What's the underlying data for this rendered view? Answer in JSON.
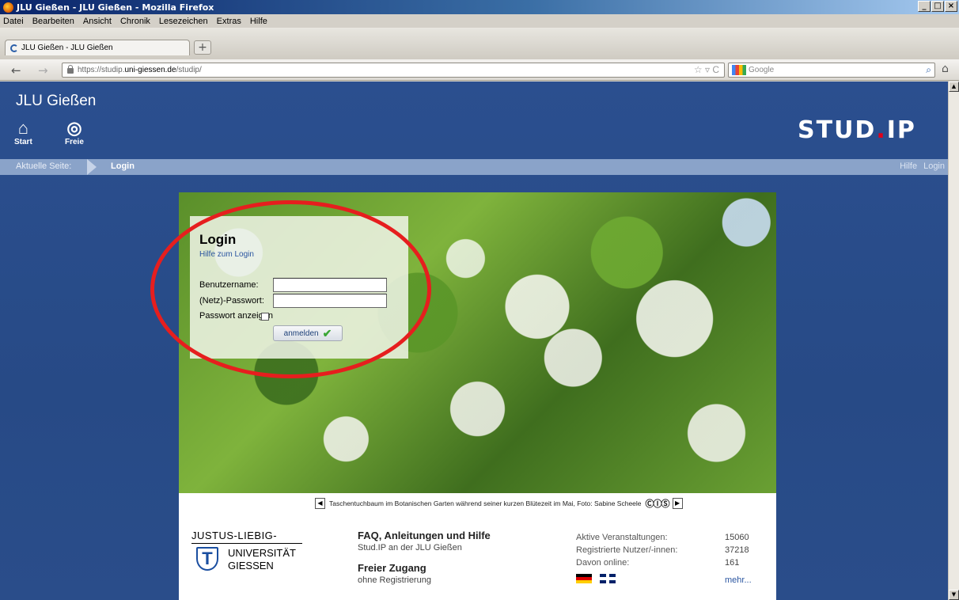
{
  "window": {
    "title": "JLU Gießen - JLU Gießen - Mozilla Firefox",
    "min": "_",
    "max": "□",
    "close": "×"
  },
  "menu": [
    "Datei",
    "Bearbeiten",
    "Ansicht",
    "Chronik",
    "Lesezeichen",
    "Extras",
    "Hilfe"
  ],
  "tab": {
    "label": "JLU Gießen - JLU Gießen",
    "new_tab": "+"
  },
  "nav": {
    "back": "←",
    "forward": "→",
    "url_prefix": "https://studip.",
    "url_host": "uni-giessen.de",
    "url_path": "/studip/",
    "url_icons": "☆ ▿ C",
    "search_placeholder": "Google",
    "search_icon": "⌕",
    "home_icon": "⌂"
  },
  "site": {
    "title": "JLU Gießen",
    "nav_items": [
      {
        "label": "Start",
        "icon": "home-icon",
        "glyph": "⌂"
      },
      {
        "label": "Freie",
        "icon": "freie-icon",
        "glyph": "◎"
      }
    ],
    "logo_main": "STUD",
    "logo_dot": ".",
    "logo_end": "IP"
  },
  "breadcrumb": {
    "label": "Aktuelle Seite:",
    "current": "Login",
    "right": [
      "Hilfe",
      "Login"
    ]
  },
  "login": {
    "title": "Login",
    "help": "Hilfe zum Login",
    "username_label": "Benutzername:",
    "password_label": "(Netz)-Passwort:",
    "show_password_label": "Passwort anzeigen",
    "submit_label": "anmelden",
    "submit_icon": "✔"
  },
  "caption": {
    "prev": "◀",
    "text": "Taschentuchbaum im Botanischen Garten während seiner kurzen Blütezeit im Mai, Foto: Sabine Scheele",
    "cc": "ⒸⒾⓈ",
    "next": "▶"
  },
  "university": {
    "line1": "JUSTUS-LIEBIG-",
    "line2": "UNIVERSITÄT",
    "line3": "GIESSEN",
    "mark": "T"
  },
  "faq": {
    "title": "FAQ, Anleitungen und Hilfe",
    "sub": "Stud.IP an der JLU Gießen",
    "free_title": "Freier Zugang",
    "free_sub": "ohne Registrierung"
  },
  "stats": [
    {
      "label": "Aktive Veranstaltungen:",
      "value": "15060"
    },
    {
      "label": "Registrierte Nutzer/-innen:",
      "value": "37218"
    },
    {
      "label": "Davon online:",
      "value": "161"
    }
  ],
  "more": "mehr...",
  "scroll": {
    "up": "▲",
    "down": "▼"
  }
}
